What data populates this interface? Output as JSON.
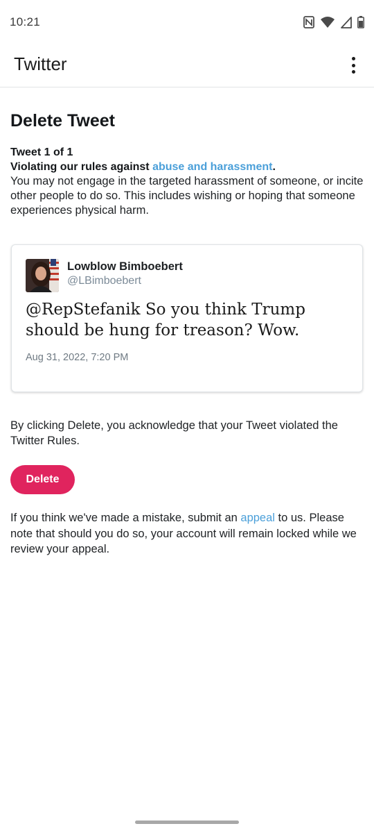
{
  "status_bar": {
    "time": "10:21",
    "icons": [
      "nfc-icon",
      "wifi-icon",
      "signal-icon",
      "battery-icon"
    ]
  },
  "app_bar": {
    "title": "Twitter",
    "menu_icon": "more-vert-icon"
  },
  "page": {
    "heading": "Delete Tweet",
    "tweet_count": "Tweet 1 of 1",
    "rule_prefix": "Violating our rules against ",
    "rule_link": "abuse and harassment",
    "rule_suffix": ".",
    "rule_description": "You may not engage in the targeted harassment of someone, or incite other people to do so. This includes wishing or hoping that someone experiences physical harm."
  },
  "tweet": {
    "author_name": "Lowblow Bimboebert",
    "author_handle": "@LBimboebert",
    "text": "@RepStefanik So you think Trump should be hung for treason? Wow.",
    "date": "Aug 31, 2022, 7:20 PM"
  },
  "acknowledgement": "By clicking Delete, you acknowledge that your Tweet violated the Twitter Rules.",
  "delete_button": "Delete",
  "appeal": {
    "prefix": "If you think we've made a mistake, submit an ",
    "link": "appeal",
    "suffix": " to us. Please note that should you do so, your account will remain locked while we review your appeal."
  },
  "colors": {
    "link": "#4a9fd9",
    "delete_button": "#e0245e",
    "handle": "#7b8a97"
  }
}
